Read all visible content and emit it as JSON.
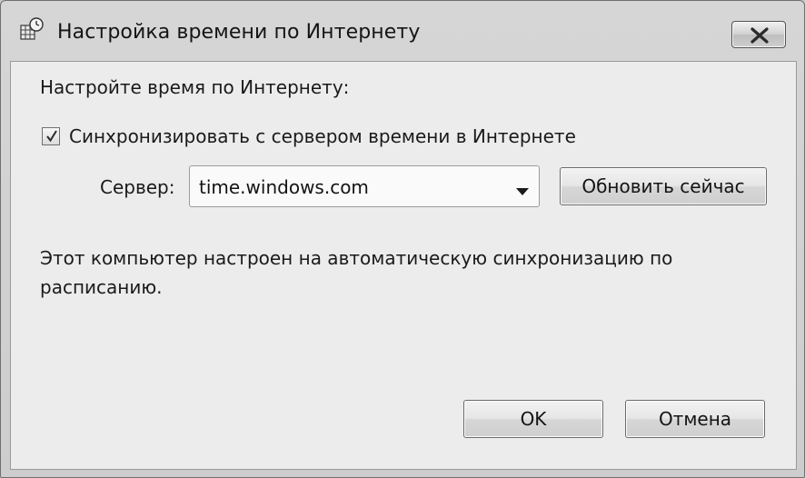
{
  "window": {
    "title": "Настройка времени по Интернету",
    "icon": "calendar-clock-icon",
    "close_icon": "close-icon"
  },
  "main": {
    "heading": "Настройте время по Интернету:",
    "sync_checkbox": {
      "checked": true,
      "label": "Синхронизировать с сервером времени в Интернете"
    },
    "server": {
      "label": "Сервер:",
      "value": "time.windows.com",
      "dropdown_icon": "chevron-down-icon"
    },
    "update_button": "Обновить сейчас",
    "info_text": "Этот компьютер настроен на автоматическую синхронизацию по расписанию."
  },
  "footer": {
    "ok_label": "OK",
    "cancel_label": "Отмена"
  }
}
